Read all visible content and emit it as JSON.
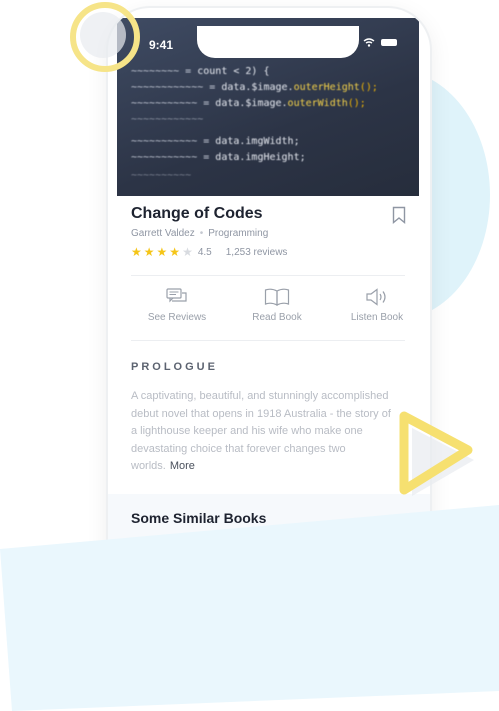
{
  "status_bar": {
    "time": "9:41"
  },
  "book": {
    "title": "Change of Codes",
    "author": "Garrett Valdez",
    "genre": "Programming",
    "rating": 4.5,
    "rating_label": "4.5",
    "stars_filled": 4,
    "stars_total": 5,
    "reviews_label": "1,253 reviews"
  },
  "hero_code": {
    "line1": "count < 2) {",
    "line2": "data.$image.",
    "line2b": "outerHeight",
    "line3": "data.$image.",
    "line3b": "outerWidth",
    "line4": "data.imgWidth;",
    "line5": "data.imgHeight;"
  },
  "actions": [
    {
      "label": "See Reviews",
      "icon": "reviews-icon"
    },
    {
      "label": "Read Book",
      "icon": "book-icon"
    },
    {
      "label": "Listen Book",
      "icon": "speaker-icon"
    }
  ],
  "prologue": {
    "heading": "PROLOGUE",
    "text": "A captivating, beautiful, and stunningly accomplished debut novel that opens in 1918 Australia - the story of a lighthouse keeper and his wife who make one devastating choice that forever changes two worlds.",
    "more_label": "More"
  },
  "similar": {
    "heading": "Some Similar Books"
  },
  "colors": {
    "star": "#f5c518",
    "accent_yellow": "#f6e488",
    "accent_blue": "#dff3fa",
    "title": "#1e2330"
  }
}
